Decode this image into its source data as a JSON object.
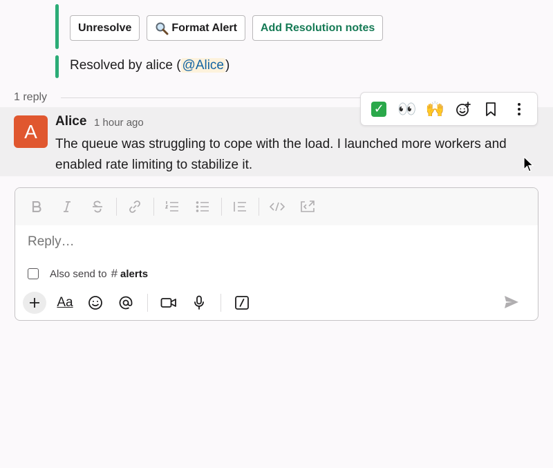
{
  "actions": {
    "unresolve": "Unresolve",
    "format_alert": "Format Alert",
    "add_resolution_notes": "Add Resolution notes"
  },
  "resolution": {
    "prefix": "Resolved by alice (",
    "mention": "@Alice",
    "suffix": ")"
  },
  "thread": {
    "reply_count": "1 reply"
  },
  "message": {
    "avatar_letter": "A",
    "author": "Alice",
    "timestamp": "1 hour ago",
    "text": "The queue was struggling to cope with the load. I launched more workers and enabled rate limiting to stabilize it."
  },
  "hover_toolbar": {
    "items": [
      "check-emoji",
      "eyes-emoji",
      "raised-hands-emoji",
      "add-reaction-icon",
      "bookmark-icon",
      "more-icon"
    ],
    "eyes": "👀",
    "raised_hands": "🙌",
    "check": "✓"
  },
  "composer": {
    "placeholder": "Reply…",
    "also_send_label": "Also send to",
    "channel_hash": "#",
    "channel_name": "alerts",
    "aa": "Aa"
  },
  "colors": {
    "accent_bar": "#2bac76",
    "avatar_bg": "#e0572f",
    "mention_bg": "#fdf2dc",
    "mention_text": "#1264a3",
    "green_button_text": "#157a55"
  }
}
